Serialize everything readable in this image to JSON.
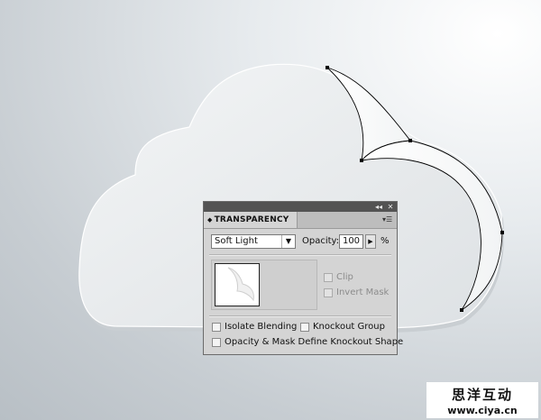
{
  "panel": {
    "tab_label": "TRANSPARENCY",
    "collapse_glyph": "◂◂",
    "close_glyph": "✕",
    "blend_mode": "Soft Light",
    "opacity_label": "Opacity:",
    "opacity_value": "100",
    "percent_sign": "%",
    "clip_label": "Clip",
    "invert_mask_label": "Invert Mask",
    "isolate_blending_label": "Isolate Blending",
    "knockout_group_label": "Knockout Group",
    "opacity_mask_label": "Opacity & Mask Define Knockout Shape",
    "clip_checked": false,
    "invert_mask_checked": false,
    "isolate_blending_checked": false,
    "knockout_group_checked": false,
    "opacity_mask_checked": false
  },
  "watermark": {
    "chinese": "思洋互动",
    "url": "www.ciya.cn"
  },
  "icons": [
    "collapse-icon",
    "close-icon",
    "panel-menu-icon",
    "dropdown-arrow-icon",
    "stepper-arrow-icon",
    "tab-arrows-icon"
  ],
  "colors": {
    "panel_bg": "#d4d4d4",
    "titlebar": "#535353",
    "cloud_fill": "#e9ecee",
    "anchor_point": "#000000"
  }
}
